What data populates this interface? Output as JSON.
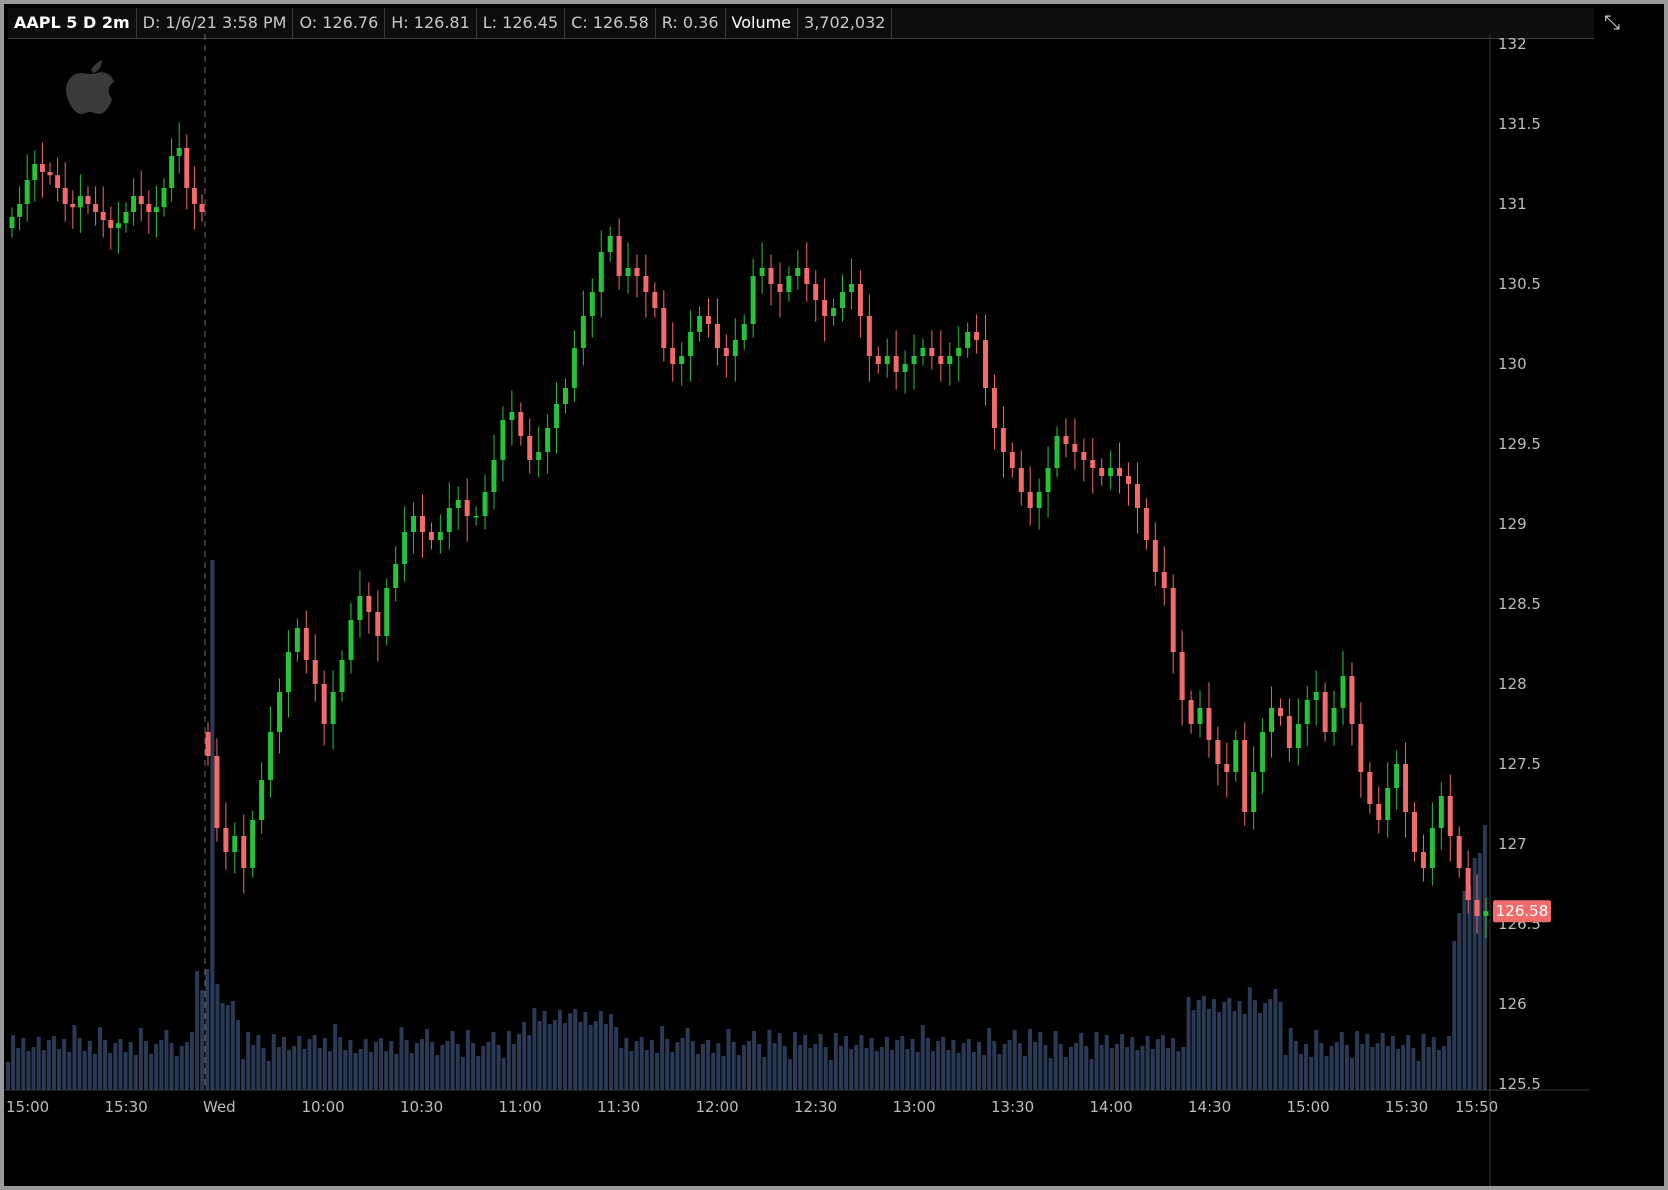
{
  "header": {
    "symbol": "AAPL 5 D 2m",
    "date": "D: 1/6/21 3:58 PM",
    "open": "O: 126.76",
    "high": "H: 126.81",
    "low": "L: 126.45",
    "close": "C: 126.58",
    "range": "R: 0.36",
    "volume_label": "Volume",
    "volume_value": "3,702,032"
  },
  "icons": {
    "logo": "apple-logo-icon",
    "toggle": "expand-collapse-icon"
  },
  "colors": {
    "up": "#27c13a",
    "down": "#f26b6b",
    "volume": "#2a3a55",
    "price_tag": "#f26b6b",
    "background": "#000000"
  },
  "chart_data": {
    "type": "candlestick",
    "symbol": "AAPL",
    "aggregation": "2m",
    "ylim": [
      125.4,
      132.2
    ],
    "y_ticks": [
      "132",
      "131.5",
      "131",
      "130.5",
      "130",
      "129.5",
      "129",
      "128.5",
      "128",
      "127.5",
      "127",
      "126.5",
      "126",
      "125.5"
    ],
    "x_ticks": [
      "15:00",
      "15:30",
      "Wed",
      "10:00",
      "10:30",
      "11:00",
      "11:30",
      "12:00",
      "12:30",
      "13:00",
      "13:30",
      "14:00",
      "14:30",
      "15:00",
      "15:30",
      "15:50"
    ],
    "last_price_label": "126.58",
    "session_divider": "Wed",
    "grid": false,
    "prev_session_close": [
      130.92,
      131.0,
      131.15,
      131.25,
      131.2,
      131.18,
      131.1,
      131.0,
      130.98,
      131.05,
      131.0,
      130.95,
      130.9,
      130.85,
      130.88,
      130.95,
      131.05,
      131.0,
      130.95,
      130.98,
      131.1,
      131.3,
      131.35,
      131.1,
      131.0,
      130.95
    ],
    "day_close": [
      127.55,
      127.1,
      126.95,
      127.05,
      126.85,
      127.15,
      127.4,
      127.7,
      127.95,
      128.2,
      128.35,
      128.15,
      128.0,
      127.75,
      127.95,
      128.15,
      128.4,
      128.55,
      128.45,
      128.3,
      128.6,
      128.75,
      128.95,
      129.05,
      128.95,
      128.9,
      128.95,
      129.1,
      129.15,
      129.05,
      129.05,
      129.2,
      129.4,
      129.65,
      129.7,
      129.55,
      129.4,
      129.45,
      129.6,
      129.75,
      129.85,
      130.1,
      130.3,
      130.45,
      130.7,
      130.8,
      130.55,
      130.6,
      130.55,
      130.45,
      130.35,
      130.1,
      130.0,
      130.05,
      130.2,
      130.3,
      130.25,
      130.1,
      130.05,
      130.15,
      130.25,
      130.55,
      130.6,
      130.5,
      130.45,
      130.55,
      130.6,
      130.5,
      130.4,
      130.3,
      130.35,
      130.45,
      130.5,
      130.3,
      130.05,
      130.0,
      130.05,
      129.95,
      130.0,
      130.05,
      130.1,
      130.05,
      130.0,
      130.05,
      130.1,
      130.2,
      130.15,
      129.85,
      129.6,
      129.45,
      129.35,
      129.2,
      129.1,
      129.2,
      129.35,
      129.55,
      129.5,
      129.45,
      129.4,
      129.35,
      129.3,
      129.35,
      129.3,
      129.25,
      129.1,
      128.9,
      128.7,
      128.6,
      128.2,
      127.9,
      127.75,
      127.85,
      127.65,
      127.5,
      127.45,
      127.65,
      127.2,
      127.45,
      127.7,
      127.85,
      127.8,
      127.6,
      127.75,
      127.9,
      127.95,
      127.7,
      127.85,
      128.05,
      127.75,
      127.45,
      127.25,
      127.15,
      127.35,
      127.5,
      127.2,
      126.95,
      126.85,
      127.1,
      127.3,
      127.05,
      126.85,
      126.65,
      126.55,
      126.58
    ]
  }
}
